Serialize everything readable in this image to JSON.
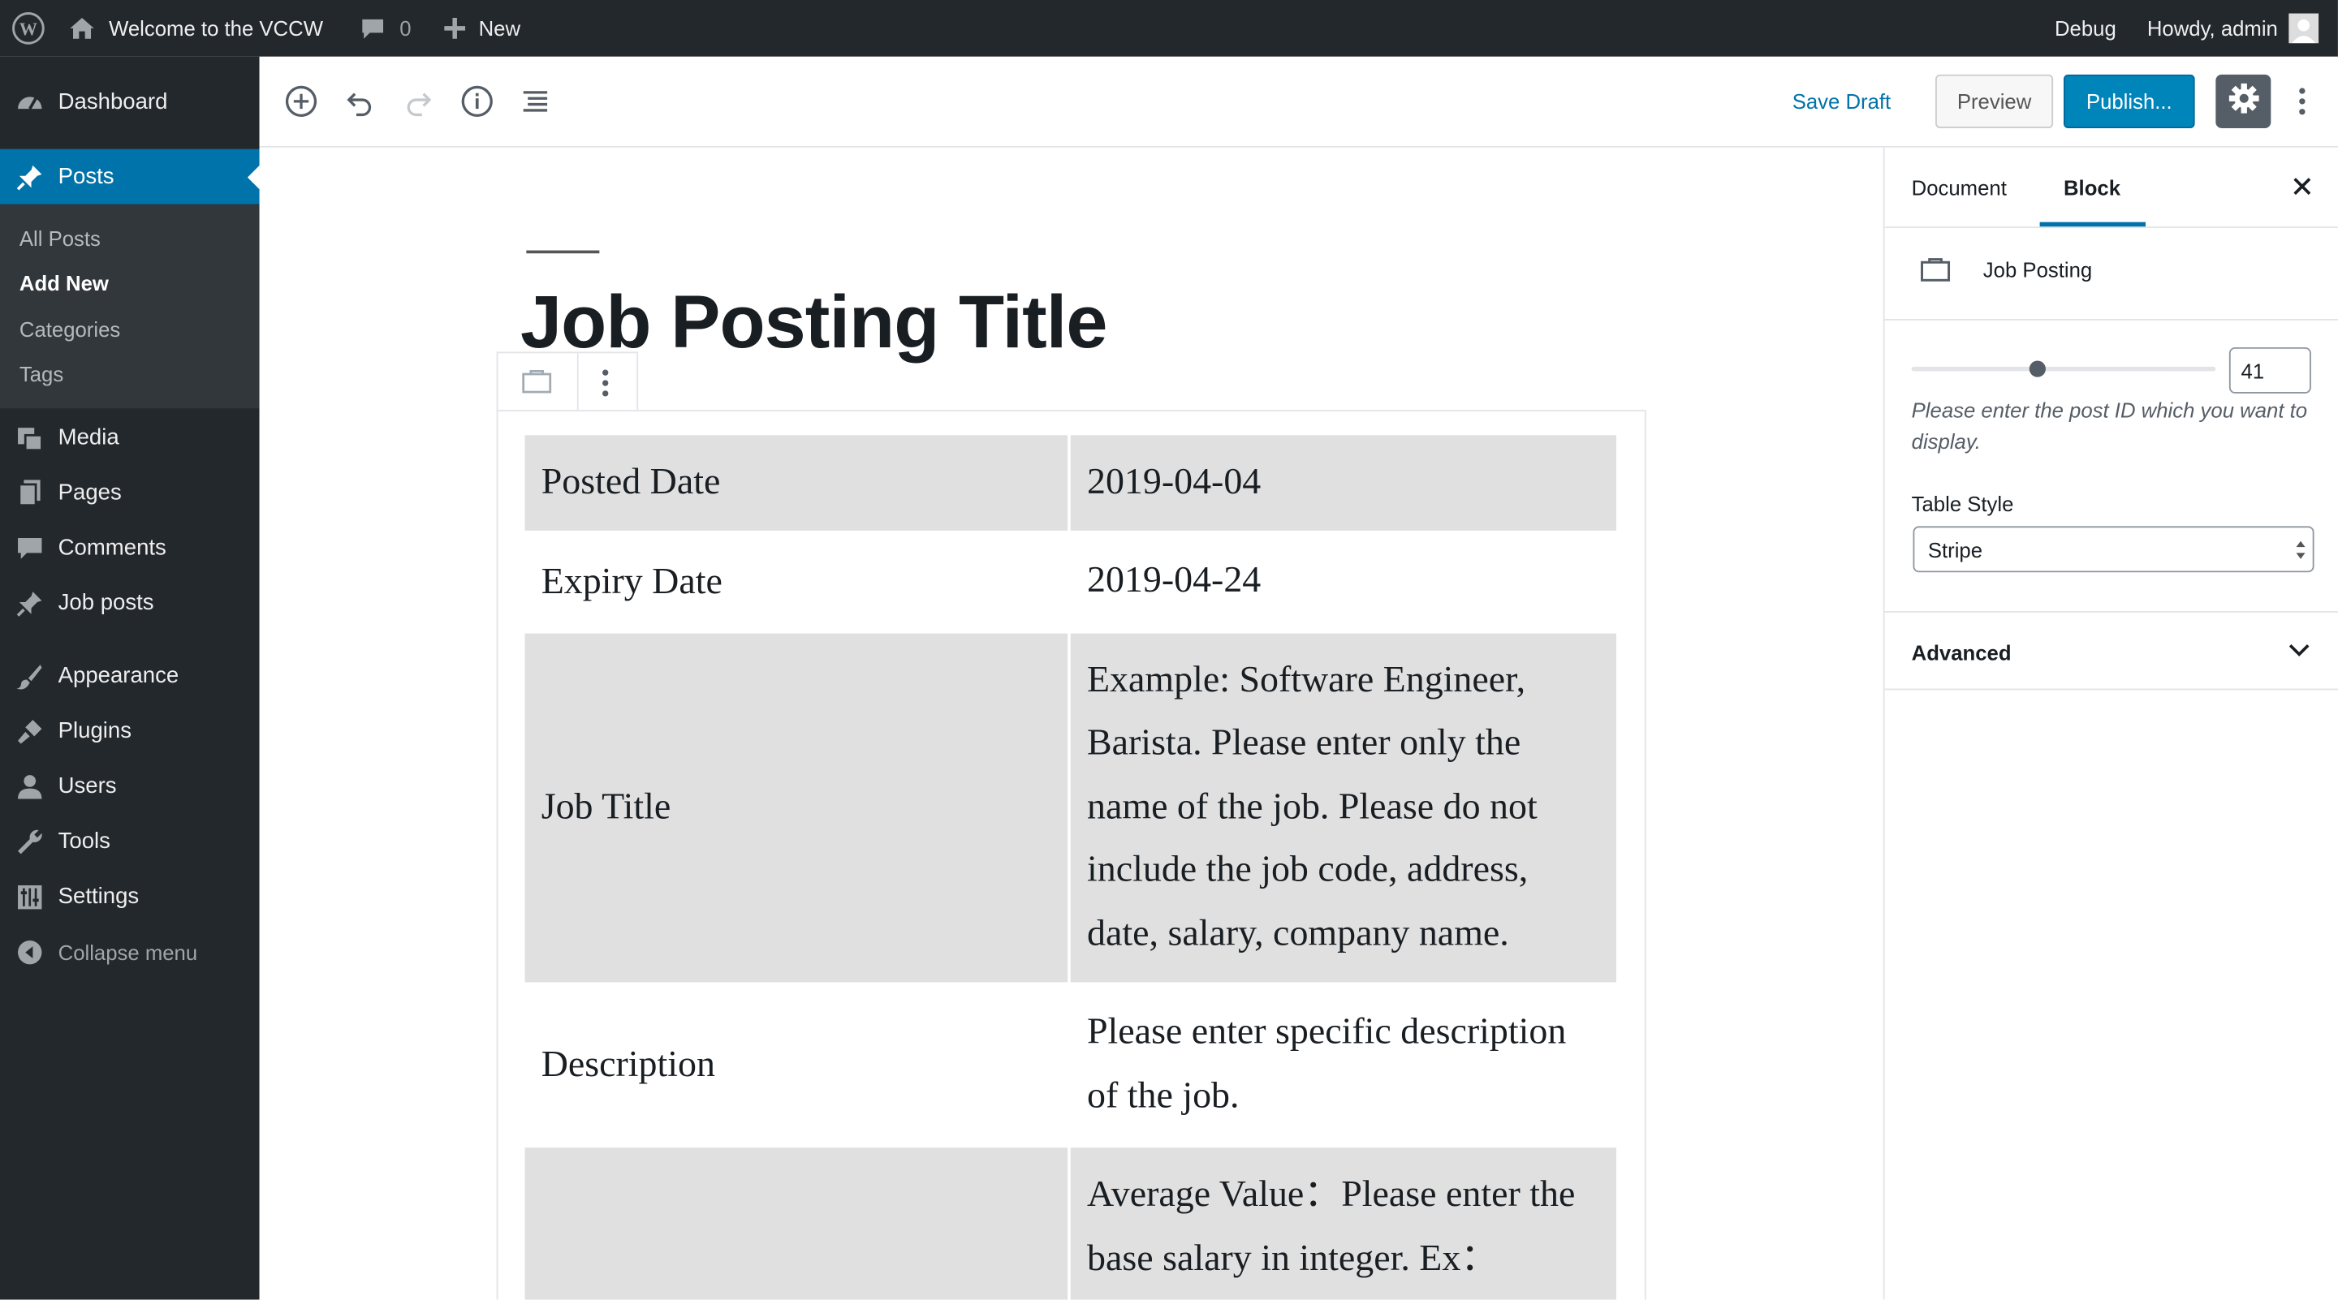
{
  "admin_bar": {
    "site_name": "Welcome to the VCCW",
    "comments_count": "0",
    "new_label": "New",
    "debug_label": "Debug",
    "howdy": "Howdy, admin"
  },
  "sidebar": {
    "dashboard": "Dashboard",
    "posts": "Posts",
    "posts_submenu": [
      "All Posts",
      "Add New",
      "Categories",
      "Tags"
    ],
    "media": "Media",
    "pages": "Pages",
    "comments": "Comments",
    "job_posts": "Job posts",
    "appearance": "Appearance",
    "plugins": "Plugins",
    "users": "Users",
    "tools": "Tools",
    "settings": "Settings",
    "collapse": "Collapse menu"
  },
  "toolbar": {
    "save_draft": "Save Draft",
    "preview": "Preview",
    "publish": "Publish..."
  },
  "editor": {
    "title": "Job Posting Title",
    "table": [
      {
        "label": "Posted Date",
        "value": "2019-04-04"
      },
      {
        "label": "Expiry Date",
        "value": "2019-04-24"
      },
      {
        "label": "Job Title",
        "value": "Example: Software Engineer, Barista. Please enter only the name of the job. Please do not include the job code, address, date, salary, company name."
      },
      {
        "label": "Description",
        "value": "Please enter specific description of the job."
      },
      {
        "label": "",
        "value": "Average Value：Please enter the base salary in integer. Ex："
      }
    ]
  },
  "settings_sidebar": {
    "tabs": [
      "Document",
      "Block"
    ],
    "active_tab": "Block",
    "block_name": "Job Posting",
    "post_id": "41",
    "post_id_help": "Please enter the post ID which you want to display.",
    "table_style_label": "Table Style",
    "table_style_value": "Stripe",
    "advanced_label": "Advanced"
  },
  "colors": {
    "admin_dark": "#23282d",
    "accent": "#0073aa",
    "stripe": "#e0e0e0"
  }
}
